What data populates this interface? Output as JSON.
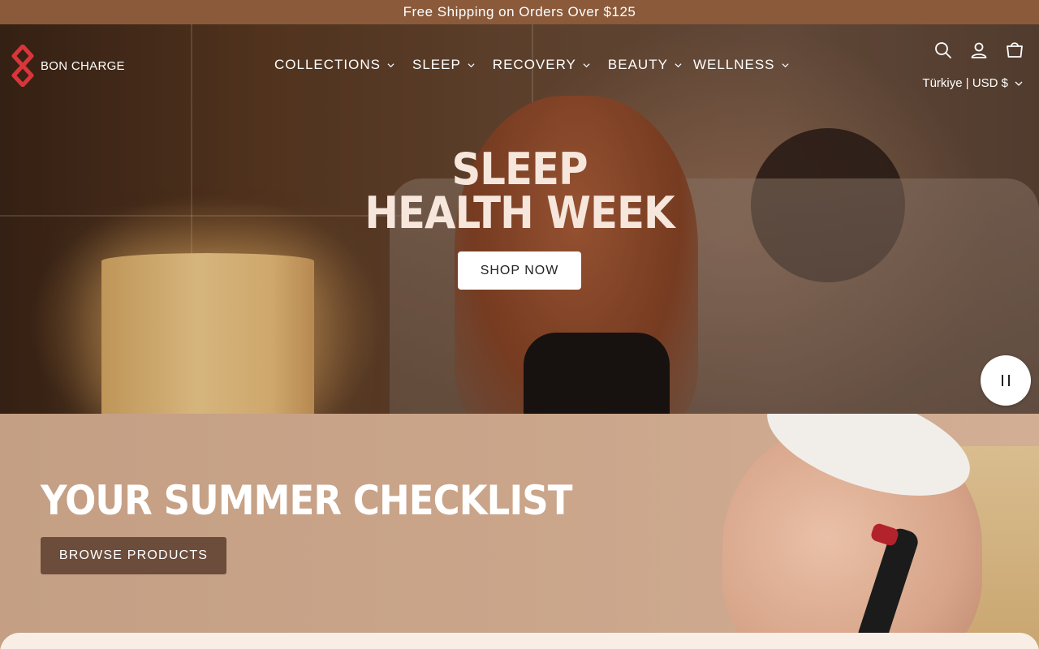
{
  "announcement": {
    "text": "Free Shipping on Orders Over $125"
  },
  "brand": {
    "name": "BON CHARGE",
    "accent": "#d8363b"
  },
  "nav": {
    "items": [
      {
        "label": "COLLECTIONS"
      },
      {
        "label": "SLEEP"
      },
      {
        "label": "RECOVERY"
      },
      {
        "label": "BEAUTY"
      },
      {
        "label": "WELLNESS"
      }
    ]
  },
  "header_icons": [
    "search-icon",
    "account-icon",
    "cart-icon"
  ],
  "currency": {
    "label": "Türkiye | USD $"
  },
  "hero": {
    "title_line1": "SLEEP",
    "title_line2": "HEALTH WEEK",
    "cta": "SHOP NOW"
  },
  "summer": {
    "title": "YOUR SUMMER CHECKLIST",
    "cta": "BROWSE PRODUCTS"
  },
  "colors": {
    "announcement_bg": "#8a5a3b",
    "browse_button": "#6c4c3b",
    "section_bg": "#c9a489"
  }
}
